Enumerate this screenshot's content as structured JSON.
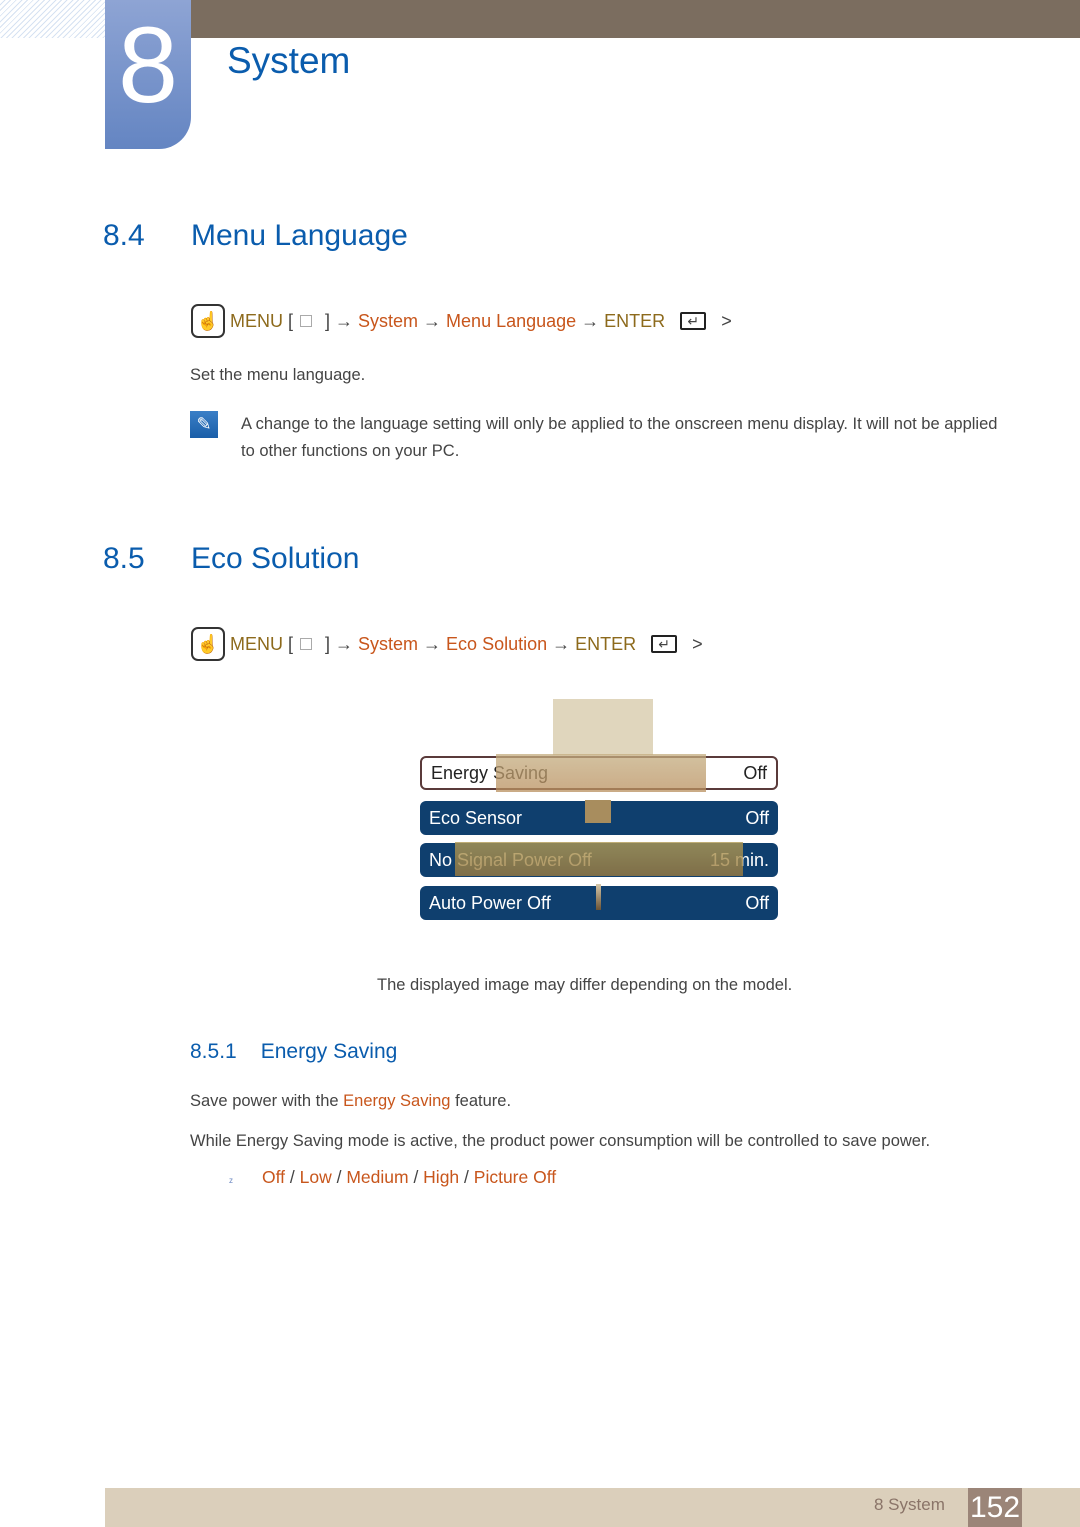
{
  "chapter": {
    "number": "8",
    "title": "System"
  },
  "sec84": {
    "number": "8.4",
    "title": "Menu Language",
    "path": {
      "menu": "MENU",
      "bracket_open": "[",
      "bracket_close": "]",
      "arrow": "→",
      "system": "System",
      "item": "Menu Language",
      "enter": "ENTER",
      "gt": ">"
    },
    "desc": "Set the menu language.",
    "note": "A change to the language setting will only be applied to the onscreen menu display. It will not be applied to other functions on your PC."
  },
  "sec85": {
    "number": "8.5",
    "title": "Eco Solution",
    "path": {
      "menu": "MENU",
      "bracket_open": "[",
      "bracket_close": "]",
      "arrow": "→",
      "system": "System",
      "item": "Eco Solution",
      "enter": "ENTER",
      "gt": ">"
    },
    "osd": [
      {
        "label": "Energy Saving",
        "value": "Off",
        "selected": true
      },
      {
        "label": "Eco Sensor",
        "value": "Off"
      },
      {
        "label": "No Signal Power Off",
        "value": "15 min."
      },
      {
        "label": "Auto Power Off",
        "value": "Off"
      }
    ],
    "caption": "The displayed image may differ depending on the model."
  },
  "sec851": {
    "number": "8.5.1",
    "title": "Energy Saving",
    "line1_pre": "Save power with the ",
    "line1_hl": "Energy Saving",
    "line1_post": " feature.",
    "line2": "While Energy Saving mode is active, the product power consumption will be controlled to save power.",
    "bullet": "z",
    "options": [
      "Off",
      "Low",
      "Medium",
      "High",
      "Picture Off"
    ],
    "sep": " / "
  },
  "footer": {
    "label": "8 System",
    "page": "152"
  },
  "colors": {
    "heading": "#0a5cad",
    "highlight": "#c8561c",
    "menu": "#8d6a1c",
    "osd": "#0f3f6e",
    "footer": "#dbcfbb"
  }
}
